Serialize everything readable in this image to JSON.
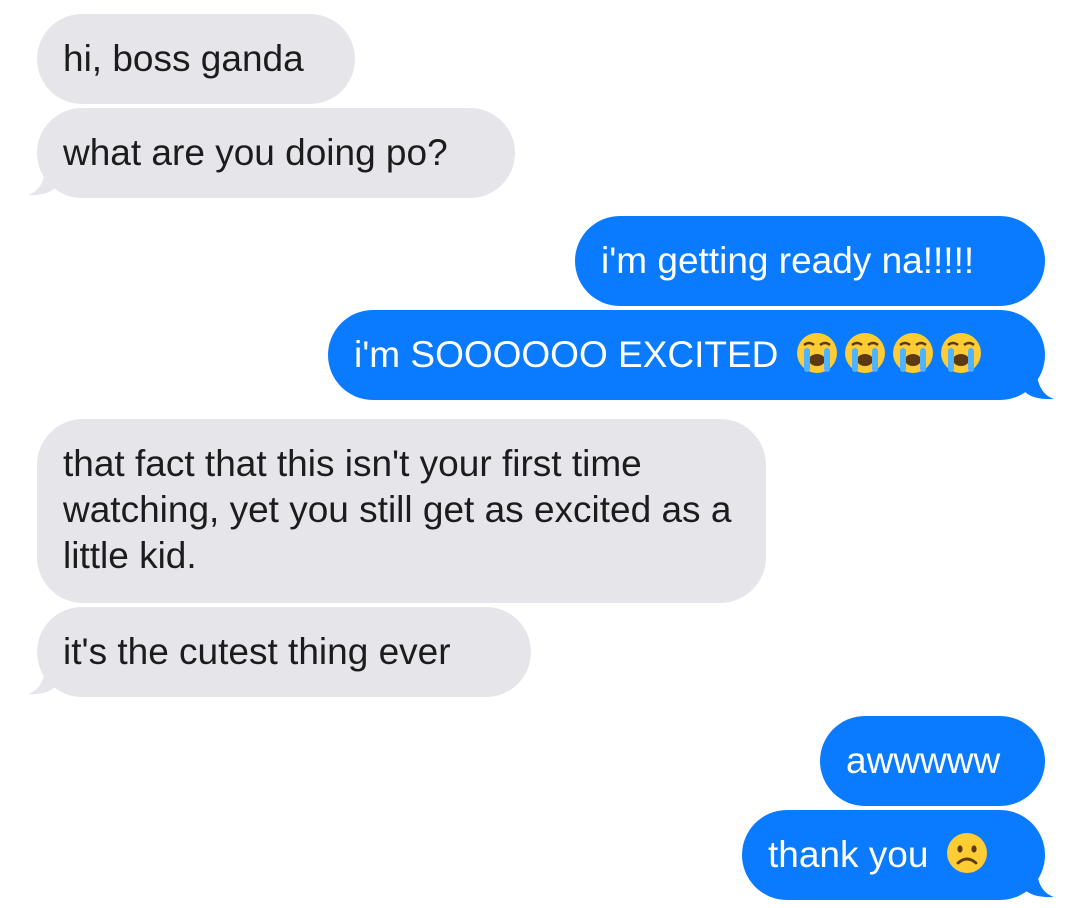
{
  "messages": [
    {
      "direction": "received",
      "text": "hi, boss ganda"
    },
    {
      "direction": "received",
      "text": "what are you doing po?"
    },
    {
      "direction": "sent",
      "text": "i'm getting ready na!!!!!"
    },
    {
      "direction": "sent",
      "text": "i'm SOOOOOO EXCITED",
      "emoji": [
        "loudly-crying-face-icon",
        "loudly-crying-face-icon",
        "loudly-crying-face-icon",
        "loudly-crying-face-icon"
      ]
    },
    {
      "direction": "received",
      "text": "that fact that this isn't your first time watching, yet you still get as excited as a little kid."
    },
    {
      "direction": "received",
      "text": "it's the cutest thing ever"
    },
    {
      "direction": "sent",
      "text": "awwwww"
    },
    {
      "direction": "sent",
      "text": "thank you",
      "emoji": [
        "frowning-face-icon"
      ]
    }
  ],
  "colors": {
    "received_bubble": "#e5e5ea",
    "received_text": "#1c1c1e",
    "sent_bubble": "#0a7bff",
    "sent_text": "#ffffff"
  }
}
